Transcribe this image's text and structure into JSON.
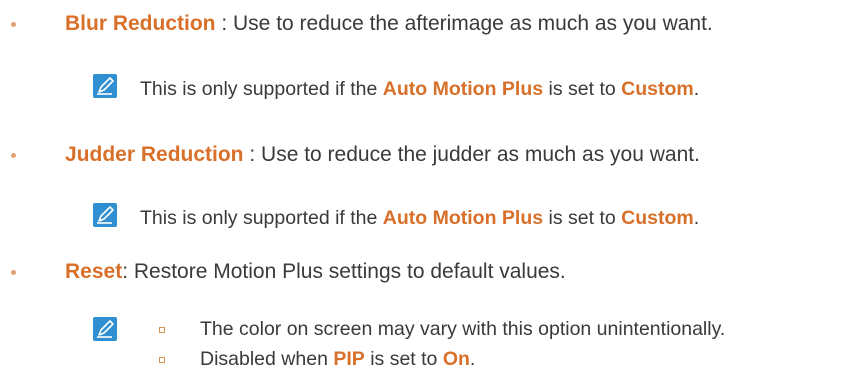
{
  "items": [
    {
      "term": "Blur Reduction",
      "sep": " : ",
      "desc": "Use to reduce the afterimage as much as you want.",
      "note": {
        "pre": "This is only supported if the ",
        "hl1": "Auto Motion Plus",
        "mid": " is set to ",
        "hl2": "Custom",
        "post": "."
      }
    },
    {
      "term": "Judder Reduction",
      "sep": " : ",
      "desc": "Use to reduce the judder as much as you want.",
      "note": {
        "pre": "This is only supported if the ",
        "hl1": "Auto Motion Plus",
        "mid": " is set to ",
        "hl2": "Custom",
        "post": "."
      }
    },
    {
      "term": "Reset",
      "sep": ": ",
      "desc": "Restore Motion Plus settings to default values.",
      "subnotes": [
        {
          "text": "The color on screen may vary with this option unintentionally."
        },
        {
          "pre": "Disabled when ",
          "hl1": "PIP",
          "mid": " is set to ",
          "hl2": "On",
          "post": "."
        }
      ]
    }
  ],
  "icon": "note-pencil-icon",
  "colors": {
    "accent": "#d9702a",
    "text": "#3a3a3a",
    "icon_blue": "#2f8fd0"
  }
}
